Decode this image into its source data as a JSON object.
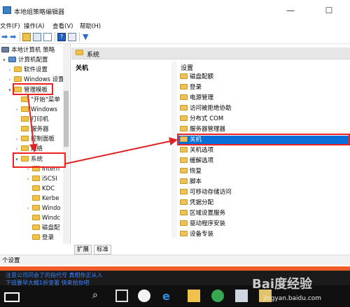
{
  "window": {
    "title": "本地组策略编辑器",
    "minimize": "—",
    "maximize": "☐"
  },
  "menu": [
    "文件(F)",
    "操作(A)",
    "查看(V)",
    "帮助(H)"
  ],
  "tree": {
    "root": "本地计算机 策略",
    "items": [
      {
        "label": "计算机配置"
      },
      {
        "label": "软件设置"
      },
      {
        "label": "Windows 设置"
      },
      {
        "label": "管理模板"
      },
      {
        "label": "\"开始\"菜单"
      },
      {
        "label": "Windows"
      },
      {
        "label": "打印机"
      },
      {
        "label": "服务器"
      },
      {
        "label": "控制面板"
      },
      {
        "label": "网络"
      },
      {
        "label": "系统"
      },
      {
        "label": "Intern"
      },
      {
        "label": "iSCSI"
      },
      {
        "label": "KDC"
      },
      {
        "label": "Kerbe"
      },
      {
        "label": "Windo"
      },
      {
        "label": "Windc"
      },
      {
        "label": "磁盘配"
      },
      {
        "label": "登录"
      }
    ]
  },
  "right": {
    "header": "系统",
    "description_title": "关机",
    "list_header": "设置",
    "items": [
      {
        "label": "磁盘配额"
      },
      {
        "label": "登录"
      },
      {
        "label": "电源管理"
      },
      {
        "label": "访问被拒绝协助"
      },
      {
        "label": "分布式 COM"
      },
      {
        "label": "服务器管理器"
      },
      {
        "label": "关机",
        "selected": true
      },
      {
        "label": "关机选项"
      },
      {
        "label": "缓解选项"
      },
      {
        "label": "恢复"
      },
      {
        "label": "脚本"
      },
      {
        "label": "可移动存储访问"
      },
      {
        "label": "凭据分配"
      },
      {
        "label": "区域设置服务"
      },
      {
        "label": "驱动程序安装"
      },
      {
        "label": "设备专装"
      }
    ],
    "tabs": [
      "扩展",
      "标准"
    ]
  },
  "status": {
    "text": "个设置"
  },
  "web_links": [
    "注意公司问会了的指代号 真相你正从入",
    "下班要早大概1折变著 快来拾你吧"
  ],
  "watermark": {
    "brand": "Bai度经验",
    "url": "jingyan.baidu.com"
  },
  "colors": {
    "selection": "#0a6fd8",
    "annotation": "#e22222",
    "accent": "#f05a28"
  }
}
